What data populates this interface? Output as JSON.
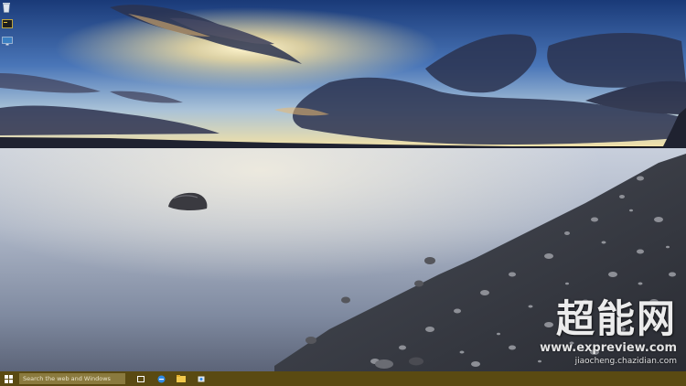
{
  "desktop": {
    "icons": [
      {
        "name": "recycle-bin-icon"
      },
      {
        "name": "terminal-icon"
      },
      {
        "name": "monitor-icon"
      }
    ],
    "wallpaper": {
      "sky_top": "#1d3f7a",
      "horizon": "#f7e6a8",
      "water": "#aab6c6"
    }
  },
  "watermark": {
    "logo": "超能网",
    "url": "www.expreview.com",
    "subtitle": "jiaocheng.chazidian.com"
  },
  "taskbar": {
    "color": "#5a4a12",
    "search_placeholder": "Search the web and Windows",
    "items": [
      {
        "name": "task-view-icon"
      },
      {
        "name": "edge-icon"
      },
      {
        "name": "file-explorer-icon"
      },
      {
        "name": "store-icon"
      }
    ]
  }
}
